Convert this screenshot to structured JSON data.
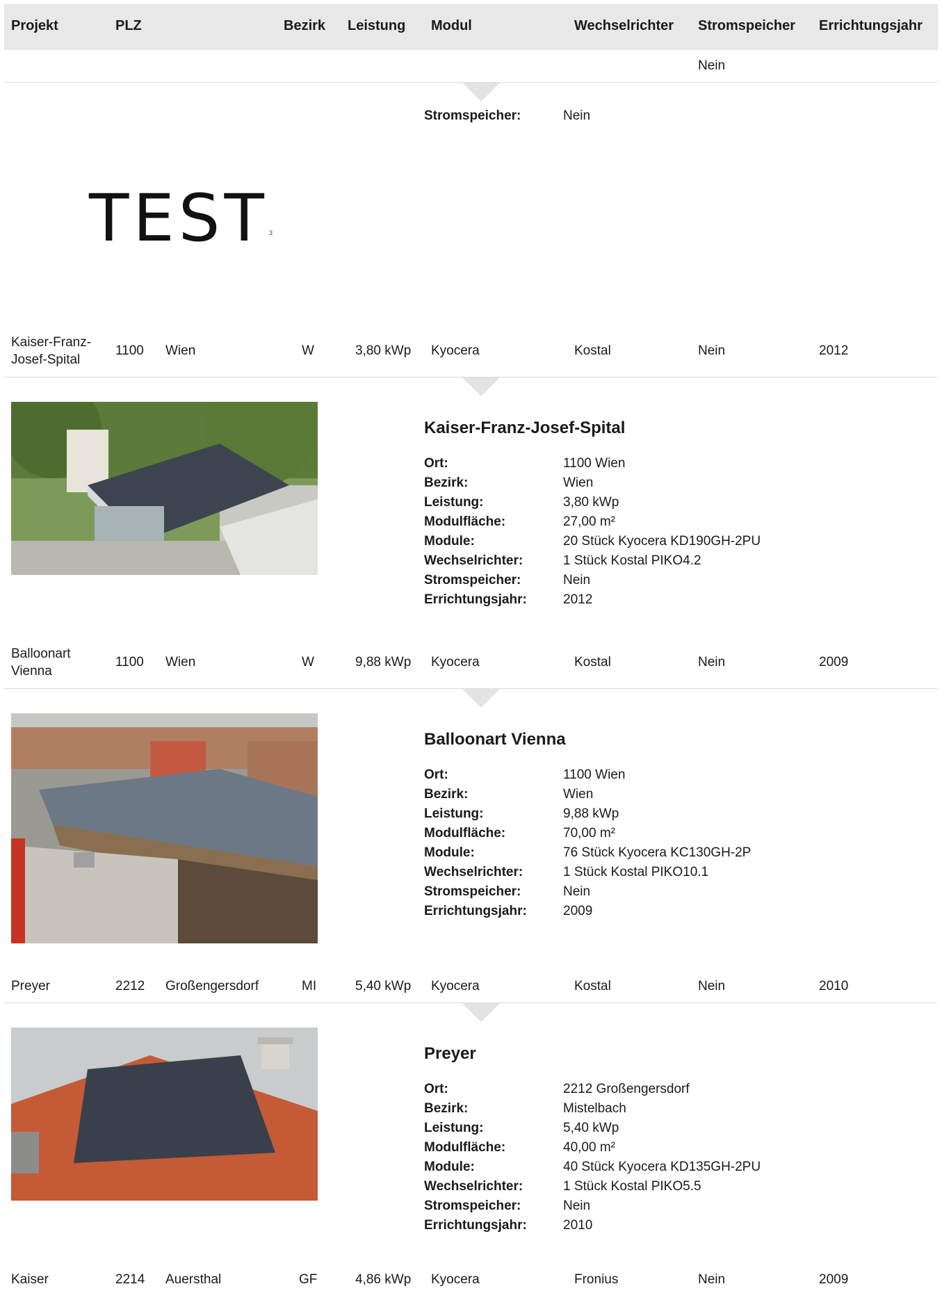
{
  "table": {
    "headers": [
      "Projekt",
      "PLZ",
      "Bezirk",
      "Leistung",
      "Modul",
      "Wechselrichter",
      "Stromspeicher",
      "Errichtungsjahr"
    ],
    "partial_row": {
      "stromspeicher": "Nein"
    },
    "test_detail": {
      "logo_text": "TEST",
      "logo_sup": "3",
      "stromspeicher_label": "Stromspeicher:",
      "stromspeicher_value": "Nein"
    },
    "rows": [
      {
        "projekt": "Kaiser-Franz-Josef-Spital",
        "plz": "1100",
        "ort": "Wien",
        "bezirk": "W",
        "leistung": "3,80 kWp",
        "modul": "Kyocera",
        "wechselrichter": "Kostal",
        "stromspeicher": "Nein",
        "jahr": "2012",
        "detail": {
          "title": "Kaiser-Franz-Josef-Spital",
          "fields": [
            {
              "label": "Ort:",
              "value": "1100 Wien"
            },
            {
              "label": "Bezirk:",
              "value": "Wien"
            },
            {
              "label": "Leistung:",
              "value": "3,80 kWp"
            },
            {
              "label": "Modulfläche:",
              "value": "27,00 m²"
            },
            {
              "label": "Module:",
              "value": "20 Stück Kyocera KD190GH-2PU"
            },
            {
              "label": "Wechselrichter:",
              "value": "1 Stück Kostal PIKO4.2"
            },
            {
              "label": "Stromspeicher:",
              "value": "Nein"
            },
            {
              "label": "Errichtungsjahr:",
              "value": "2012"
            }
          ]
        }
      },
      {
        "projekt": "Balloonart Vienna",
        "plz": "1100",
        "ort": "Wien",
        "bezirk": "W",
        "leistung": "9,88 kWp",
        "modul": "Kyocera",
        "wechselrichter": "Kostal",
        "stromspeicher": "Nein",
        "jahr": "2009",
        "detail": {
          "title": "Balloonart Vienna",
          "fields": [
            {
              "label": "Ort:",
              "value": "1100 Wien"
            },
            {
              "label": "Bezirk:",
              "value": "Wien"
            },
            {
              "label": "Leistung:",
              "value": "9,88 kWp"
            },
            {
              "label": "Modulfläche:",
              "value": "70,00 m²"
            },
            {
              "label": "Module:",
              "value": "76 Stück Kyocera KC130GH-2P"
            },
            {
              "label": "Wechselrichter:",
              "value": "1 Stück Kostal PIKO10.1"
            },
            {
              "label": "Stromspeicher:",
              "value": "Nein"
            },
            {
              "label": "Errichtungsjahr:",
              "value": "2009"
            }
          ]
        }
      },
      {
        "projekt": "Preyer",
        "plz": "2212",
        "ort": "Großengersdorf",
        "bezirk": "MI",
        "leistung": "5,40 kWp",
        "modul": "Kyocera",
        "wechselrichter": "Kostal",
        "stromspeicher": "Nein",
        "jahr": "2010",
        "detail": {
          "title": "Preyer",
          "fields": [
            {
              "label": "Ort:",
              "value": "2212 Großengersdorf"
            },
            {
              "label": "Bezirk:",
              "value": "Mistelbach"
            },
            {
              "label": "Leistung:",
              "value": "5,40 kWp"
            },
            {
              "label": "Modulfläche:",
              "value": "40,00 m²"
            },
            {
              "label": "Module:",
              "value": "40 Stück Kyocera KD135GH-2PU"
            },
            {
              "label": "Wechselrichter:",
              "value": "1 Stück Kostal PIKO5.5"
            },
            {
              "label": "Stromspeicher:",
              "value": "Nein"
            },
            {
              "label": "Errichtungsjahr:",
              "value": "2010"
            }
          ]
        }
      },
      {
        "projekt": "Kaiser",
        "plz": "2214",
        "ort": "Auersthal",
        "bezirk": "GF",
        "leistung": "4,86 kWp",
        "modul": "Kyocera",
        "wechselrichter": "Fronius",
        "stromspeicher": "Nein",
        "jahr": "2009"
      }
    ]
  }
}
